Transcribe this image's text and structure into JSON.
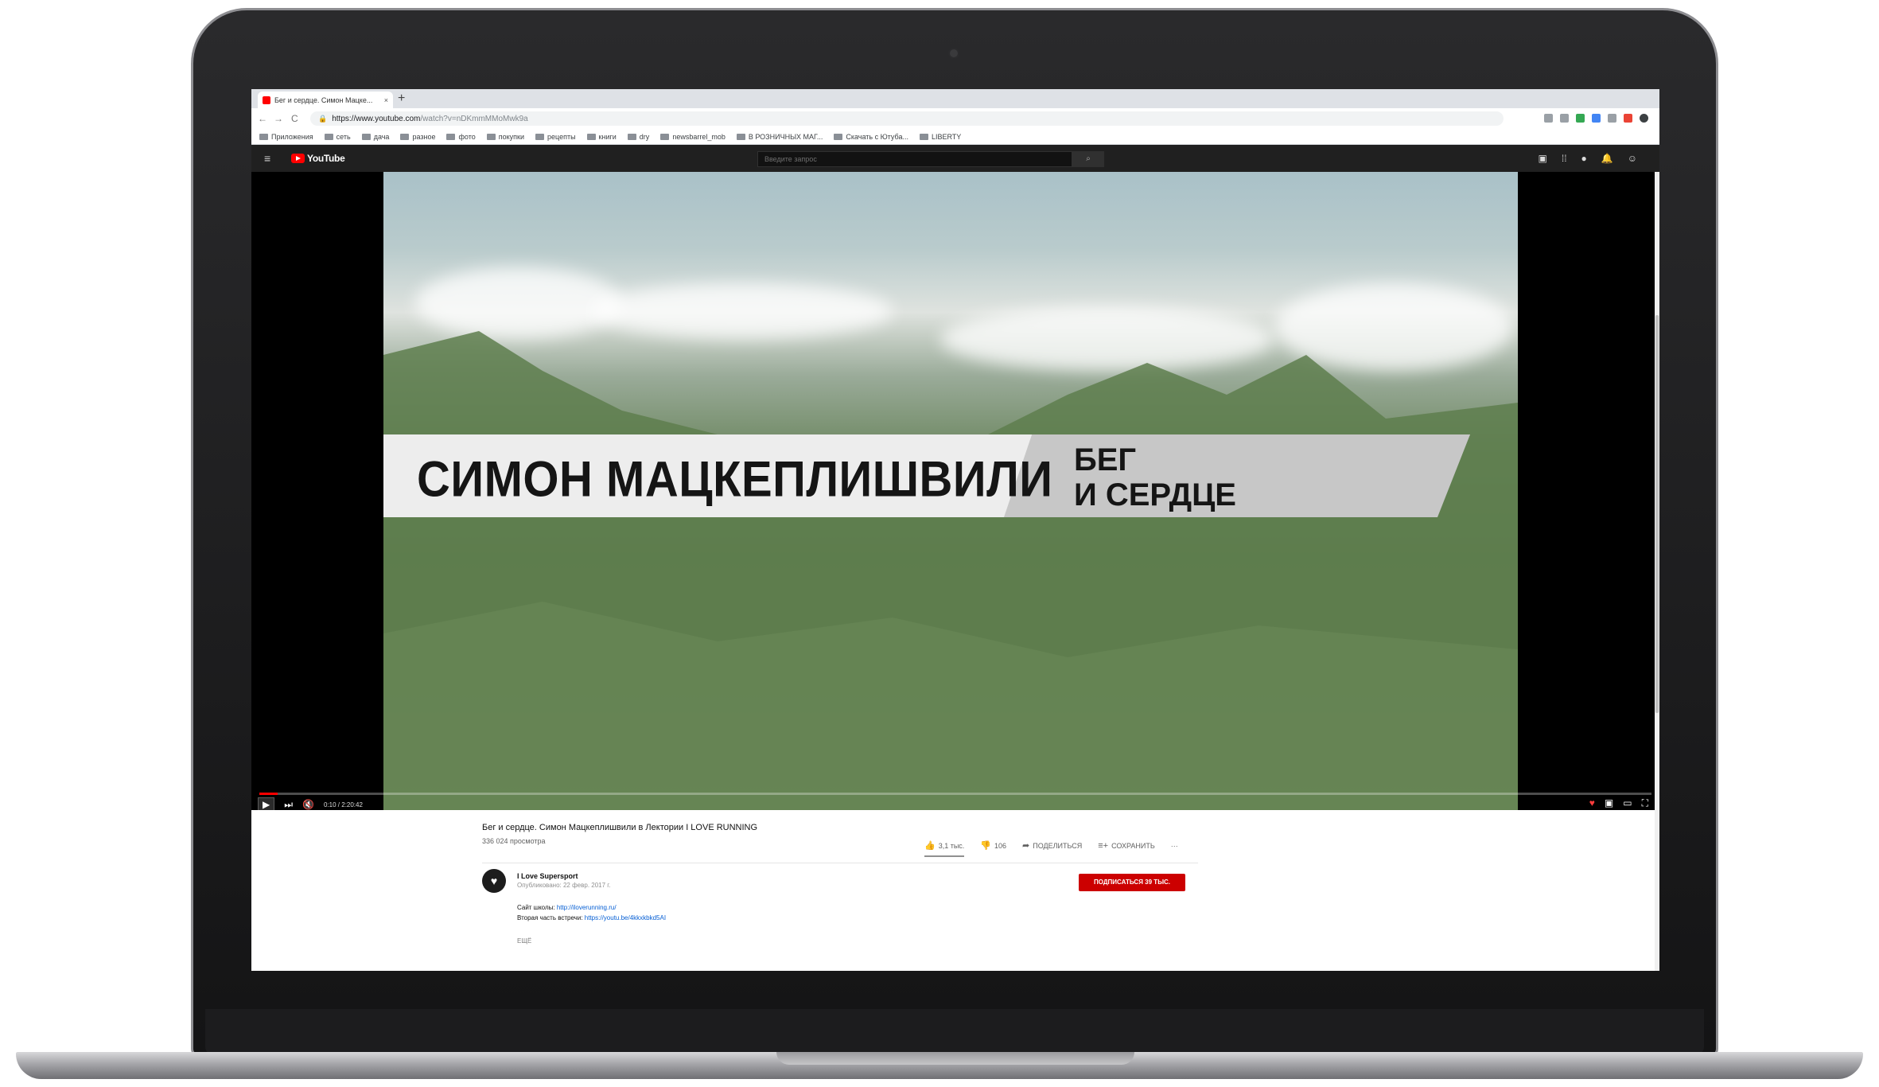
{
  "browser": {
    "tab_title": "Бег и сердце. Симон Мацке...",
    "tab_close": "×",
    "new_tab": "+",
    "nav": {
      "back": "←",
      "forward": "→",
      "reload": "C"
    },
    "lock": "🔒",
    "url_main": "https://www.youtube.com",
    "url_rest": "/watch?v=nDKmmMMoMwk9a",
    "bookmarks": [
      "Приложения",
      "сеть",
      "дача",
      "разное",
      "фото",
      "покупки",
      "рецепты",
      "книги",
      "dry",
      "newsbarrel_mob",
      "В РОЗНИЧНЫХ МАГ...",
      "Скачать с Ютуба...",
      "LIBERTY"
    ]
  },
  "youtube": {
    "logo_text": "YouTube",
    "search_placeholder": "Введите запрос",
    "search_button": "⌕",
    "hamburger": "≡",
    "icons": {
      "upload": "▣",
      "apps": "⁞⁞",
      "messages": "●",
      "notifications": "🔔",
      "account": "☺"
    }
  },
  "video": {
    "overlay_left": "СИМОН МАЦКЕПЛИШВИЛИ",
    "overlay_right_line1": "БЕГ",
    "overlay_right_line2": "И СЕРДЦЕ",
    "time": "0:10 / 2:20:42",
    "progress_fraction": 0.0013
  },
  "page": {
    "title": "Бег и сердце. Симон Мацкеплишвили в Лектории I LOVE RUNNING",
    "views": "336 024 просмотра",
    "likes": "3,1 тыс.",
    "dislikes": "106",
    "share": "ПОДЕЛИТЬСЯ",
    "save": "СОХРАНИТЬ",
    "more_actions": "···",
    "channel_name": "I Love Supersport",
    "published": "Опубликовано: 22 февр. 2017 г.",
    "subscribe": "ПОДПИСАТЬСЯ 39 ТЫС.",
    "desc_line1_label": "Сайт школы:",
    "desc_line1_link": "http://iloverunning.ru/",
    "desc_line2_label": "Вторая часть встречи:",
    "desc_line2_link": "https://youtu.be/4kkxkbkd5AI",
    "more": "ЕЩЁ"
  }
}
